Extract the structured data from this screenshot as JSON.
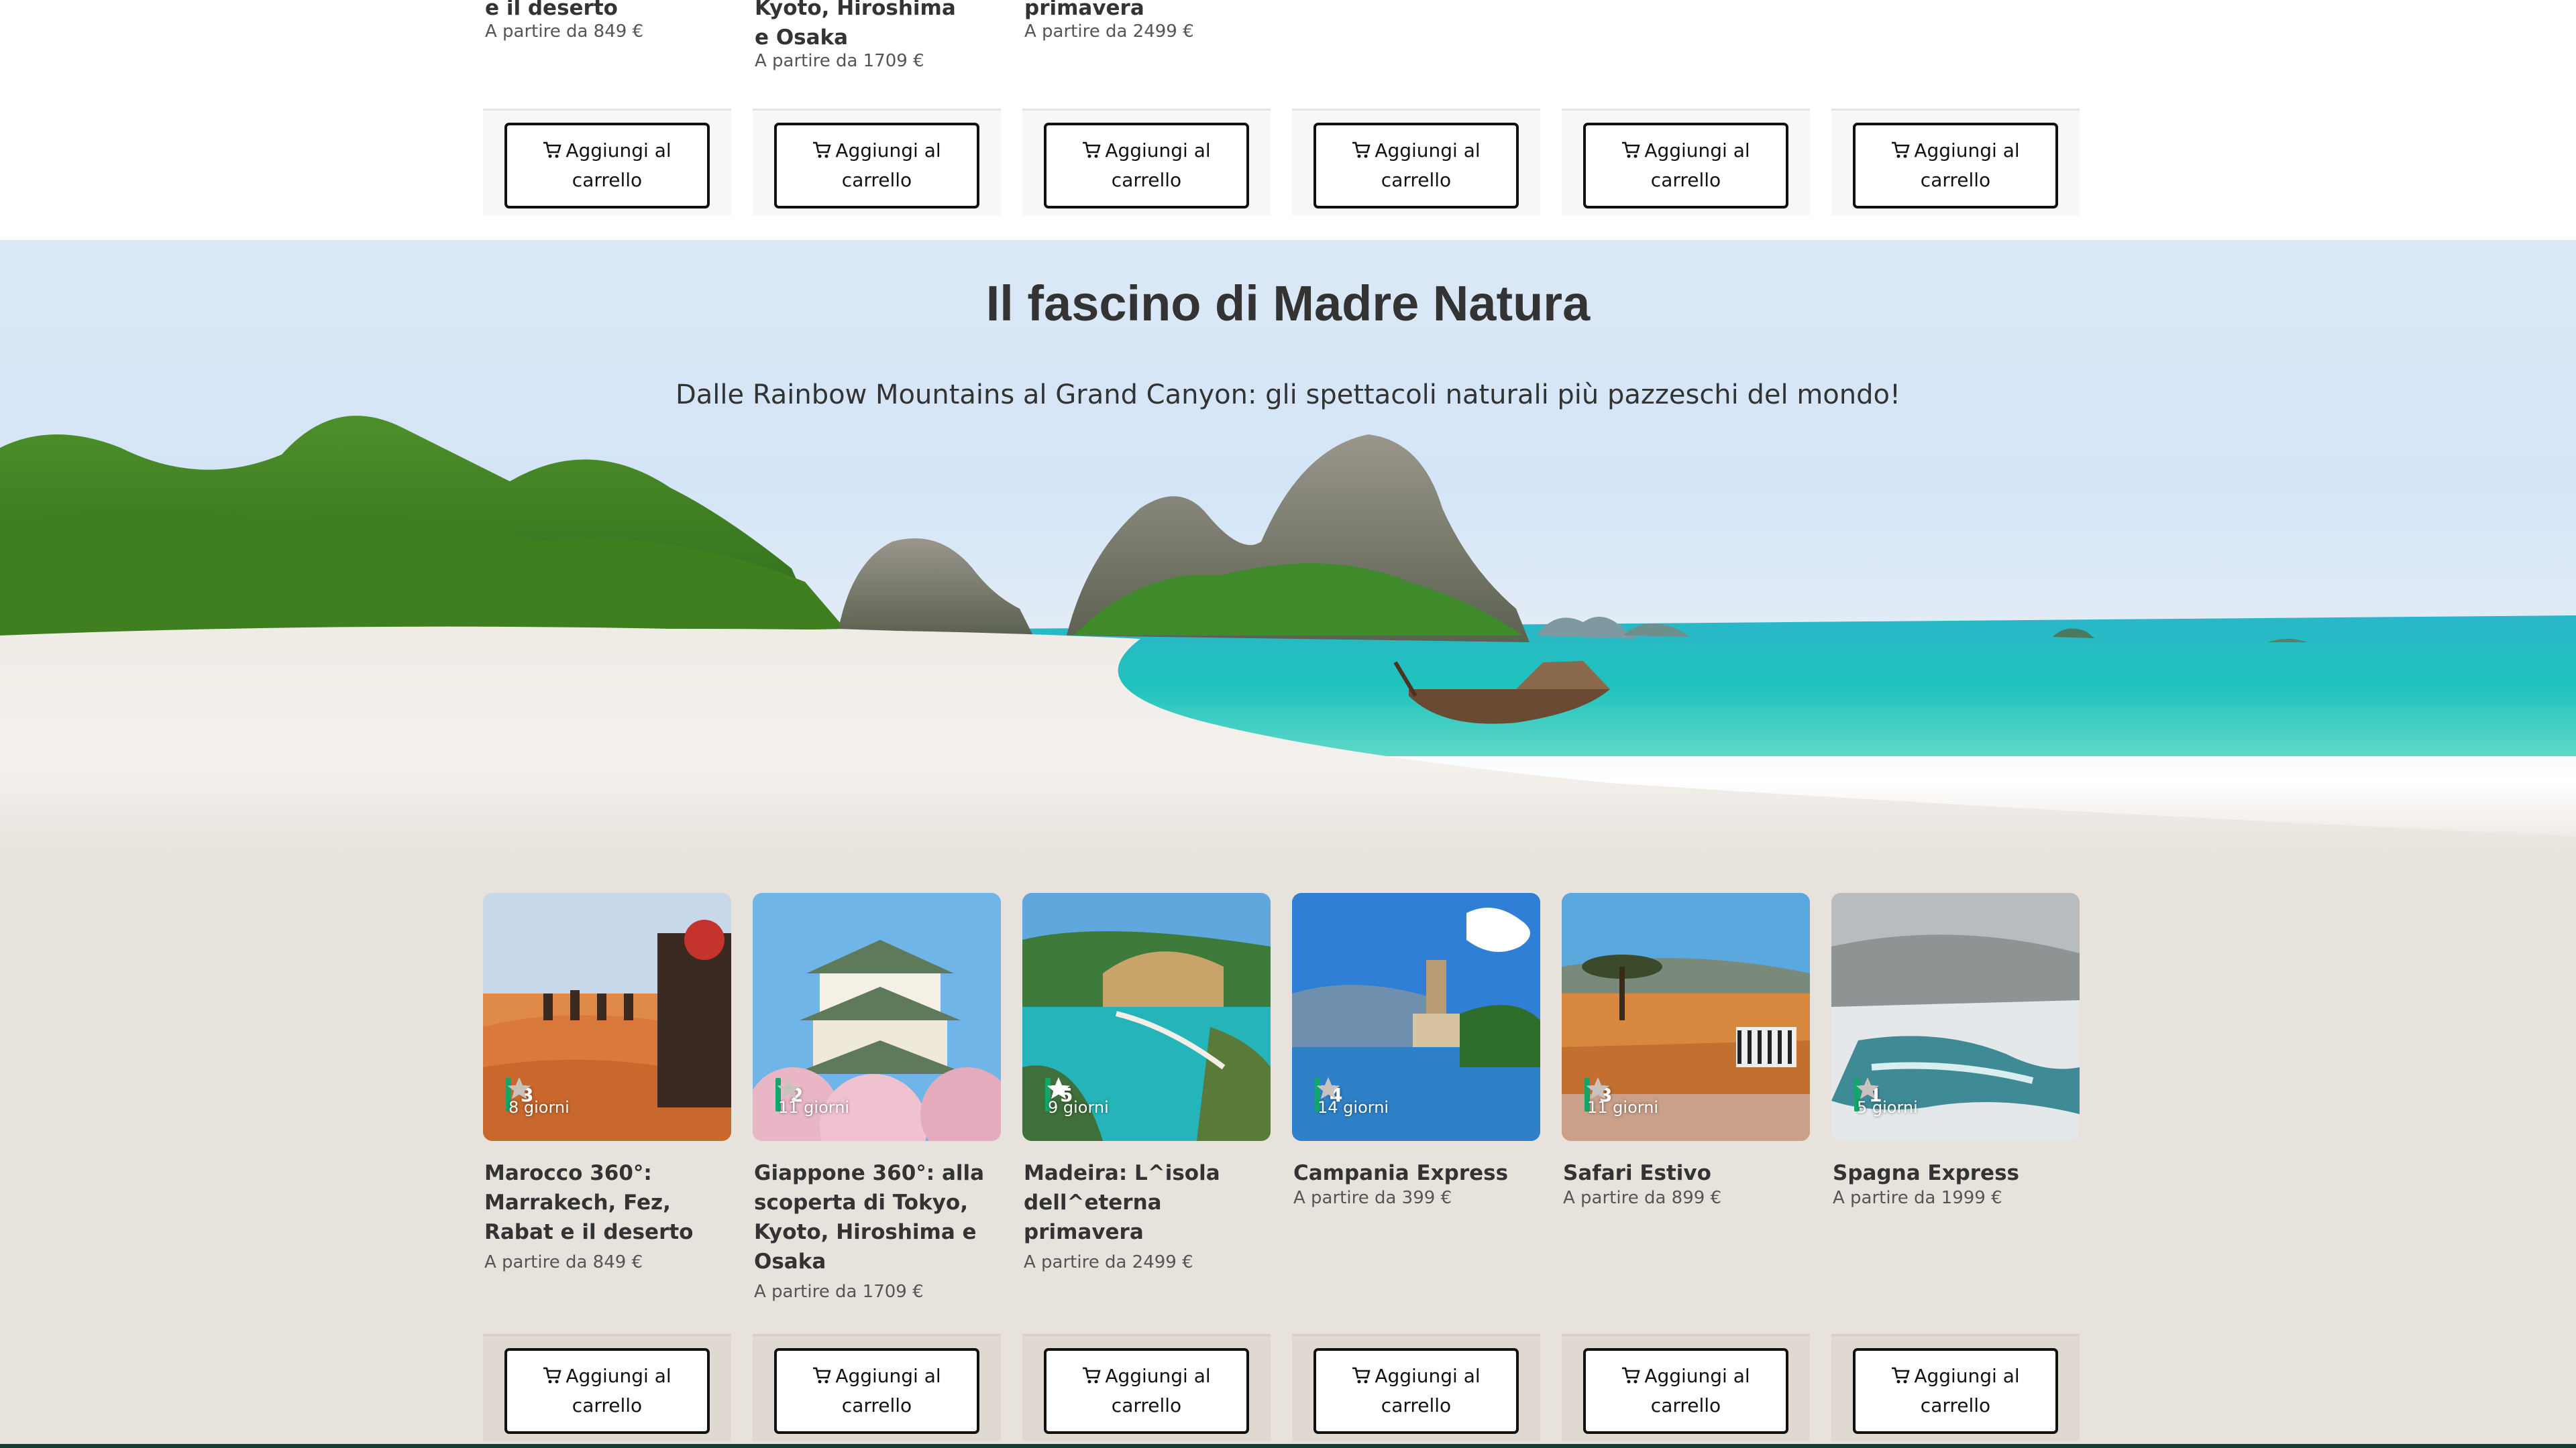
{
  "top_section": {
    "cards": [
      {
        "title_tail": "e il deserto",
        "price": "A partire da 849 €"
      },
      {
        "title_tail": "Kyoto, Hiroshima e Osaka",
        "price": "A partire da 1709 €"
      },
      {
        "title_tail": "primavera",
        "price": "A partire da 2499 €"
      },
      {
        "title_tail": "",
        "price": ""
      },
      {
        "title_tail": "",
        "price": ""
      },
      {
        "title_tail": "",
        "price": ""
      }
    ],
    "cart_button_label": "Aggiungi al carrello"
  },
  "nature_section": {
    "title": "Il fascino di Madre Natura",
    "subtitle": "Dalle Rainbow Mountains al Grand Canyon: gli spettacoli naturali più pazzeschi del mondo!",
    "cart_button_label": "Aggiungi al carrello",
    "tours": [
      {
        "title": "Marocco 360°: Marrakech, Fez, Rabat e il deserto",
        "price": "A partire da 849 €",
        "rating_stars": 3,
        "rating_count": "3",
        "days": "8 giorni"
      },
      {
        "title": "Giappone 360°: alla scoperta di Tokyo, Kyoto, Hiroshima e Osaka",
        "price": "A partire da 1709 €",
        "rating_stars": 4,
        "rating_count": "2",
        "days": "11 giorni"
      },
      {
        "title": "Madeira: L^isola dell^eterna primavera",
        "price": "A partire da 2499 €",
        "rating_stars": 5,
        "rating_count": "5",
        "days": "9 giorni"
      },
      {
        "title": "Campania Express",
        "price": "A partire da 399 €",
        "rating_stars": 4,
        "rating_count": "4",
        "days": "14 giorni"
      },
      {
        "title": "Safari Estivo",
        "price": "A partire da 899 €",
        "rating_stars": 3,
        "rating_count": "3",
        "days": "11 giorni"
      },
      {
        "title": "Spagna Express",
        "price": "A partire da 1999 €",
        "rating_stars": 1,
        "rating_count": "1",
        "days": "5 giorni"
      }
    ]
  },
  "colors": {
    "rating_green": "#12a66a",
    "section_bg": "#e8e2dc",
    "banner_sky": "#d4e5f7"
  },
  "icons": {
    "cart": "cart-icon",
    "star": "star-icon"
  }
}
